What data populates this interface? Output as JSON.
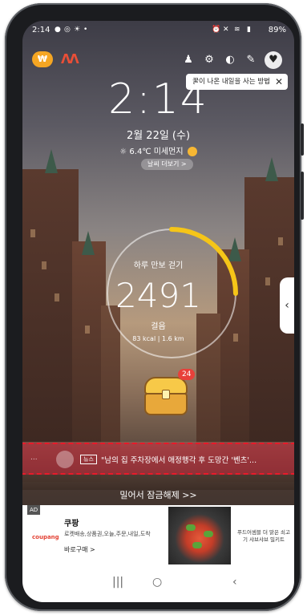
{
  "status_bar": {
    "time": "2:14",
    "battery": "89%"
  },
  "tooltip": {
    "text": "꿀이 나온 내일을 사는 방법",
    "close": "✕"
  },
  "lock_screen": {
    "clock": "2:14",
    "date": "2월 22일 (수)",
    "weather": "6.4℃ 미세먼지",
    "weather_link": "날씨 더보기 >"
  },
  "steps": {
    "title": "하루 만보 걷기",
    "count": "2491",
    "unit": "걸음",
    "calories": "83 kcal",
    "distance": "1.6 km",
    "progress_fraction": 0.25
  },
  "chest": {
    "badge": "24"
  },
  "news": {
    "tag": "뉴스",
    "headline": "\"남의 집 주차장에서 애정행각 후 도망간 '벤츠'...",
    "dots": "..."
  },
  "unlock_text": "밀어서 잠금해제 >>",
  "ad": {
    "tag": "AD",
    "brand": "coupang",
    "title": "쿠팡",
    "description": "로켓배송,상품권,오늘,주문,내일,도착",
    "cta": "바로구매 >",
    "side_text": "푸드어셈블 더 맑은 쇠고기 샤브샤브 밀키트"
  },
  "nav": {
    "home": "○",
    "back": "‹"
  },
  "colors": {
    "ring_progress": "#f5c518",
    "news_bg": "#c8283c",
    "news_border": "#e81a2a"
  }
}
